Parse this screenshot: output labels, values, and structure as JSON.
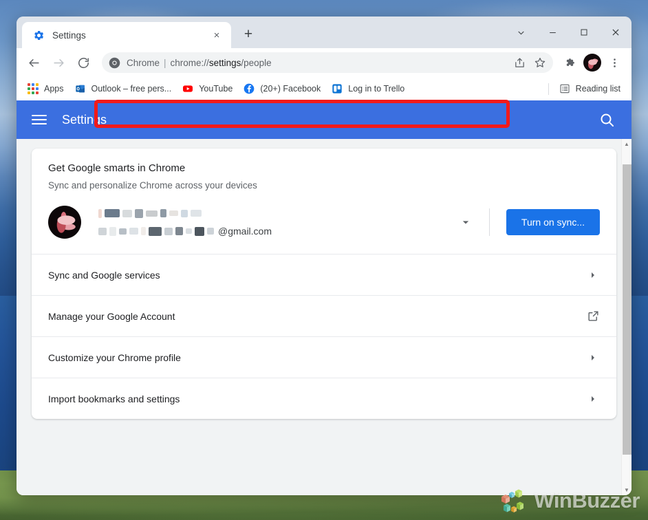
{
  "window": {
    "controls": [
      {
        "name": "tab-search",
        "glyph": "chevron-down-icon"
      },
      {
        "name": "minimize",
        "glyph": "minimize-icon"
      },
      {
        "name": "maximize",
        "glyph": "maximize-icon"
      },
      {
        "name": "close",
        "glyph": "close-icon"
      }
    ]
  },
  "tab": {
    "title": "Settings",
    "favicon": "gear-icon",
    "close_label": "×",
    "newtab_label": "+"
  },
  "toolbar": {
    "back": "back-arrow-icon",
    "forward": "forward-arrow-icon",
    "reload": "reload-icon",
    "omnibox": {
      "icon": "chrome-logo-icon",
      "prefix": "Chrome",
      "separator": "|",
      "url_prefix": "chrome://",
      "url_strong": "settings",
      "url_suffix": "/people",
      "full_url": "chrome://settings/people"
    },
    "share": "share-icon",
    "bookmark_star": "star-icon",
    "extensions": "puzzle-icon",
    "profile": "avatar",
    "menu": "three-dot-menu-icon"
  },
  "bookmarks_bar": {
    "apps_label": "Apps",
    "items": [
      {
        "label": "Outlook – free pers...",
        "icon": "outlook-icon"
      },
      {
        "label": "YouTube",
        "icon": "youtube-icon"
      },
      {
        "label": "(20+) Facebook",
        "icon": "facebook-icon"
      },
      {
        "label": "Log in to Trello",
        "icon": "trello-icon"
      }
    ],
    "reading_list_label": "Reading list",
    "reading_list_icon": "reading-list-icon",
    "highlight_color": "#f21a1a"
  },
  "settings": {
    "header_title": "Settings",
    "menu_icon": "hamburger-menu-icon",
    "search_icon": "search-icon",
    "accent_color": "#3b6fe0",
    "sync_card": {
      "title": "Get Google smarts in Chrome",
      "subtitle": "Sync and personalize Chrome across your devices",
      "account_email_suffix": "@gmail.com",
      "turn_on_sync_label": "Turn on sync...",
      "button_color": "#1a73e8",
      "dropdown_icon": "chevron-down-icon"
    },
    "rows": [
      {
        "label": "Sync and Google services",
        "icon": "chevron-right-icon"
      },
      {
        "label": "Manage your Google Account",
        "icon": "external-link-icon"
      },
      {
        "label": "Customize your Chrome profile",
        "icon": "chevron-right-icon"
      },
      {
        "label": "Import bookmarks and settings",
        "icon": "chevron-right-icon"
      }
    ]
  },
  "watermark": {
    "text": "WinBuzzer"
  }
}
